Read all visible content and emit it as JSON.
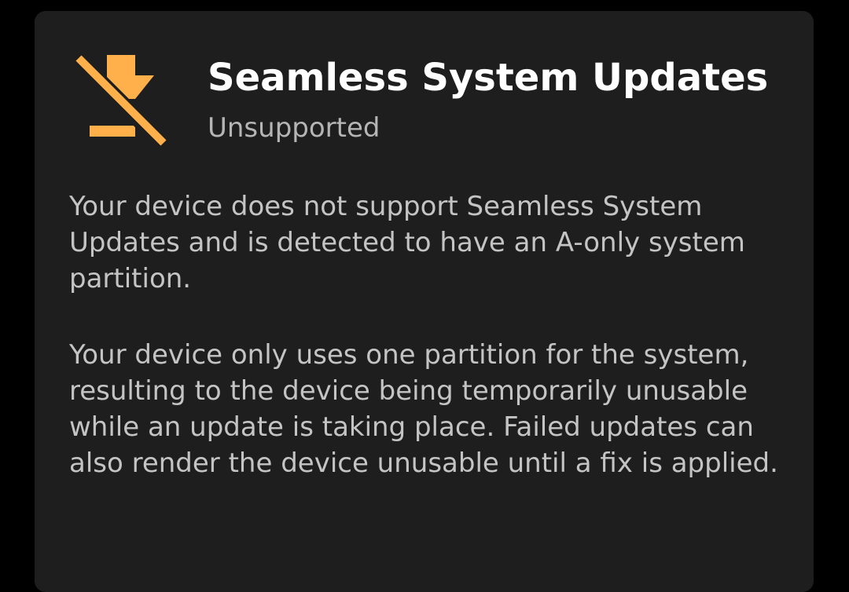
{
  "card": {
    "icon": "flash-off-download-icon",
    "title": "Seamless System Updates",
    "status": "Unsupported",
    "paragraphs": [
      "Your device does not support Seamless System Updates and is detected to have an A-only system partition.",
      "Your device only uses one partition for the system, resulting to the device being temporarily unusable while an update is taking place. Failed updates can also render the device unusable until a fix is applied."
    ]
  },
  "colors": {
    "accent": "#ffb04a",
    "background": "#000000",
    "card": "#1e1e1e"
  }
}
